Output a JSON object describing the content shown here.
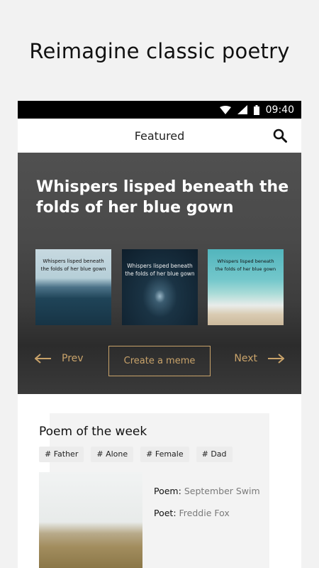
{
  "promo": {
    "title": "Reimagine classic poetry"
  },
  "status_bar": {
    "time": "09:40"
  },
  "app_bar": {
    "title": "Featured"
  },
  "hero": {
    "title": "Whispers lisped beneath the folds of her blue gown",
    "thumbnails": [
      {
        "caption_line1": "Whispers lisped beneath",
        "caption_line2": "the folds of her blue gown"
      },
      {
        "caption_line1": "Whispers lisped beneath",
        "caption_line2": "the folds of her blue gown"
      },
      {
        "caption_line1": "Whispers lisped beneath",
        "caption_line2": "the folds of her blue gown"
      }
    ],
    "prev_label": "Prev",
    "next_label": "Next",
    "create_label": "Create a meme"
  },
  "poem_of_week": {
    "title": "Poem of the week",
    "tags": [
      "# Father",
      "# Alone",
      "# Female",
      "# Dad"
    ],
    "poem_label": "Poem:",
    "poem_value": "September Swim",
    "poet_label": "Poet:",
    "poet_value": "Freddie Fox"
  },
  "colors": {
    "accent": "#c9a36a",
    "status_bar": "#000000"
  }
}
